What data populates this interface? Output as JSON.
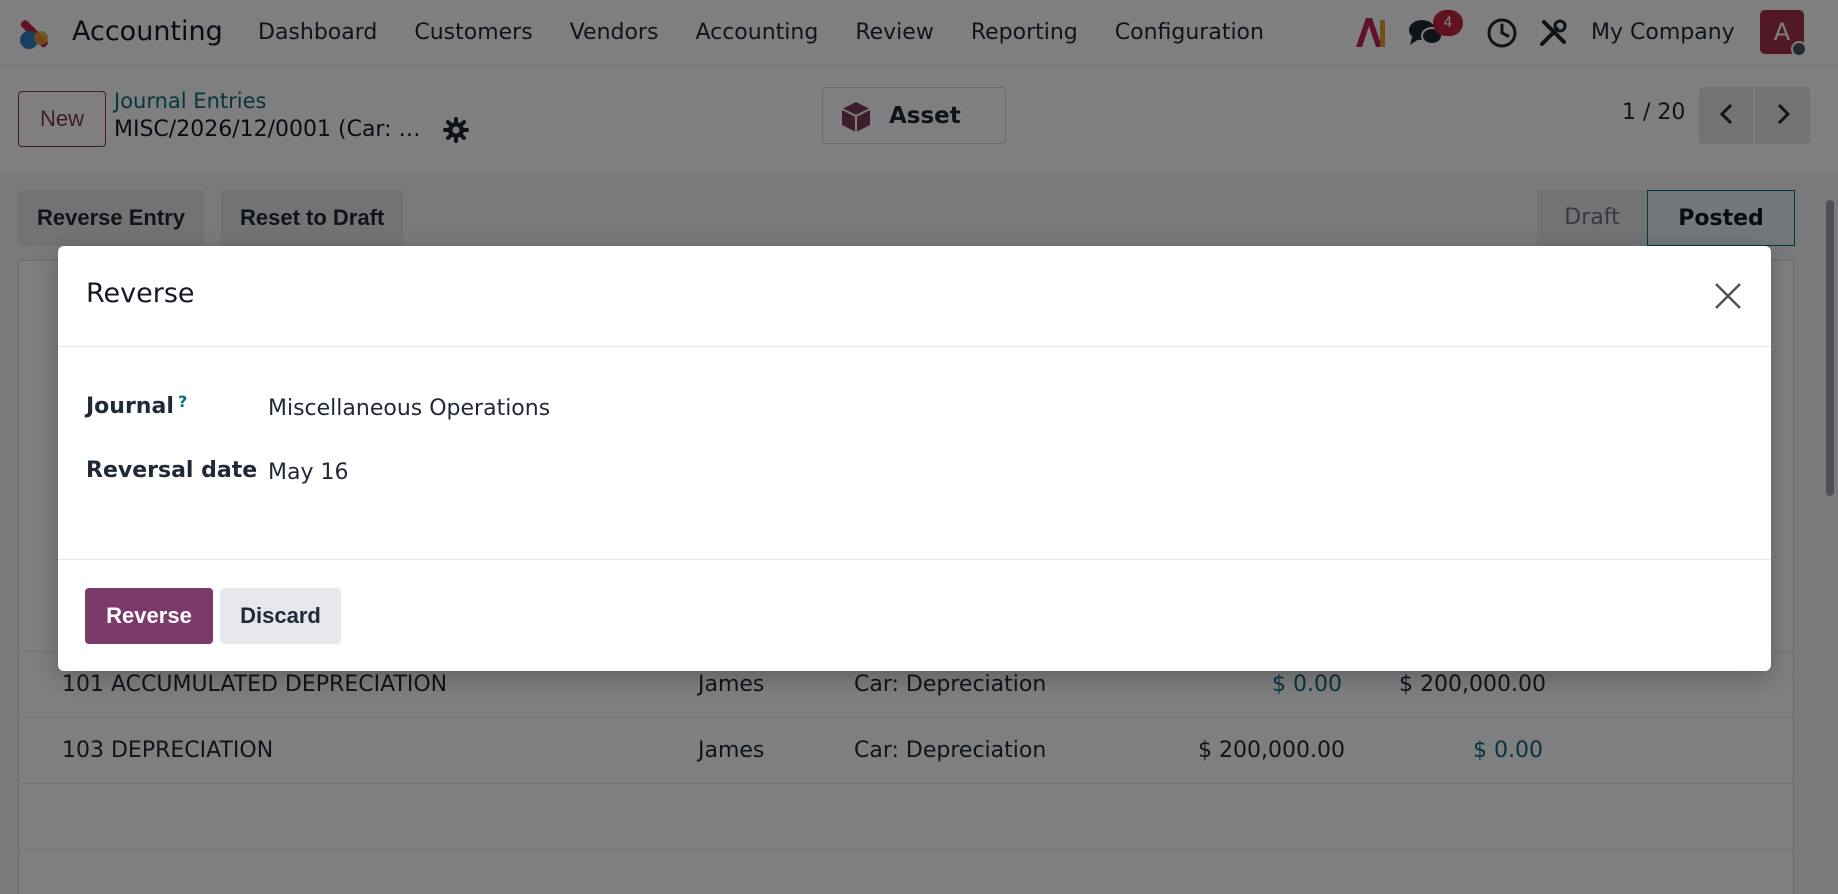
{
  "navbar": {
    "app_name": "Accounting",
    "menu": [
      "Dashboard",
      "Customers",
      "Vendors",
      "Accounting",
      "Review",
      "Reporting",
      "Configuration"
    ],
    "chat_badge": "4",
    "company": "My Company",
    "avatar_initial": "A"
  },
  "control": {
    "new_label": "New",
    "breadcrumb_parent": "Journal Entries",
    "record_title": "MISC/2026/12/0001 (Car: …",
    "asset_label": "Asset",
    "pager": "1 / 20"
  },
  "form": {
    "reverse_entry_label": "Reverse Entry",
    "reset_draft_label": "Reset to Draft",
    "status_draft": "Draft",
    "status_posted": "Posted",
    "lines": [
      {
        "account": "101 ACCUMULATED DEPRECIATION",
        "partner": "James",
        "label": "Car: Depreciation",
        "debit": "$ 0.00",
        "credit": "$ 200,000.00"
      },
      {
        "account": "103 DEPRECIATION",
        "partner": "James",
        "label": "Car: Depreciation",
        "debit": "$ 200,000.00",
        "credit": "$ 0.00"
      }
    ]
  },
  "modal": {
    "title": "Reverse",
    "journal_label": "Journal",
    "journal_help": "?",
    "journal_value": "Miscellaneous Operations",
    "date_label": "Reversal date",
    "date_value": "May 16",
    "reverse_button": "Reverse",
    "discard_button": "Discard"
  },
  "colors": {
    "brand": "#7c3a6a",
    "badge": "#c0243c",
    "link": "#0f6b7f"
  }
}
